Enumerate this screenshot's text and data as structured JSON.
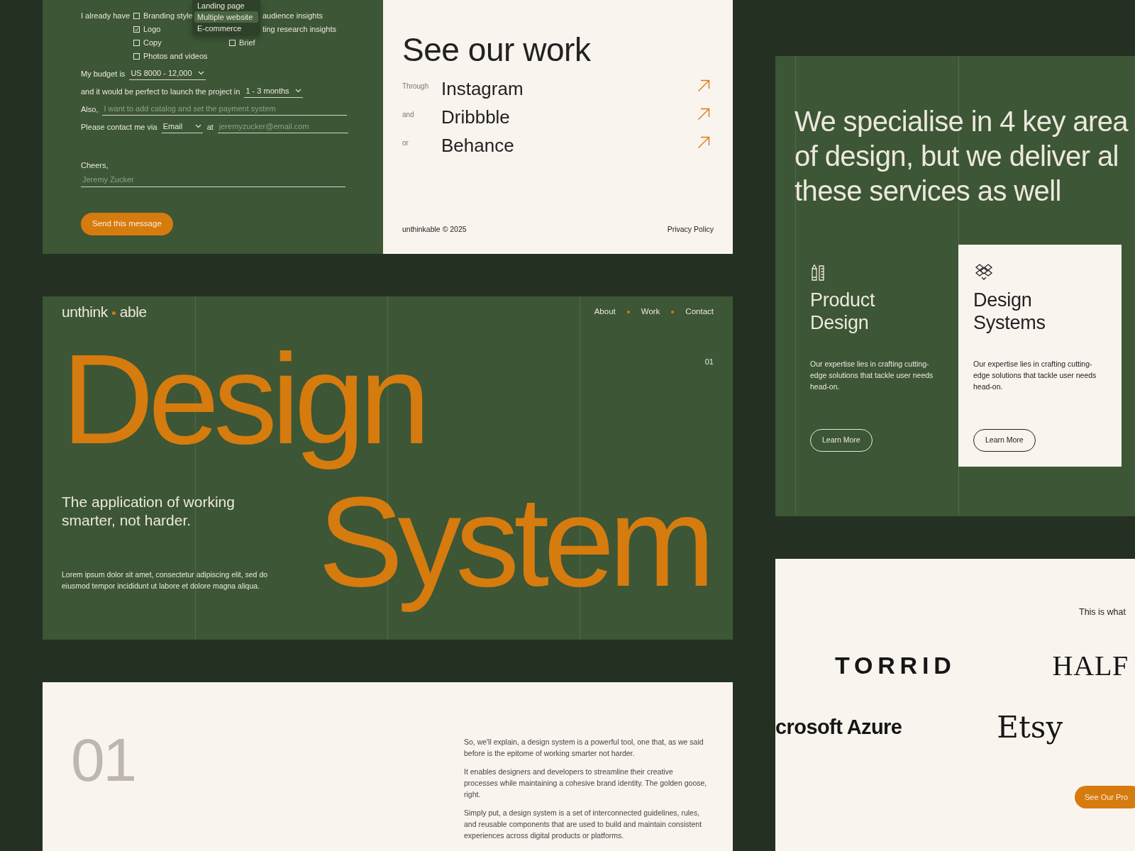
{
  "contact_form": {
    "have_label": "I already have",
    "options": [
      {
        "label": "Branding style",
        "checked": false
      },
      {
        "label": "Logo",
        "checked": true
      },
      {
        "label": "Copy",
        "checked": false
      },
      {
        "label": "Photos and videos",
        "checked": false
      }
    ],
    "options_2": [
      {
        "label": "audience insights"
      },
      {
        "label": "ting research insights"
      },
      {
        "label": "Brief",
        "checked": false
      }
    ],
    "dropdown": [
      {
        "label": "Landing page",
        "selected": false
      },
      {
        "label": "Multiple website",
        "selected": true
      },
      {
        "label": "E-commerce",
        "selected": false
      }
    ],
    "budget": {
      "label": "My budget is",
      "value": "US 8000 - 12,000"
    },
    "launch": {
      "label": "and it would be perfect to launch the project in",
      "value": "1 - 3 months"
    },
    "also": {
      "label": "Also,",
      "placeholder": "I want to add catalog and set the payment system"
    },
    "contact": {
      "label": "Please contact me via",
      "value": "Email",
      "at_label": "at",
      "placeholder": "jeremyzucker@email.com"
    },
    "closing": "Cheers,",
    "name": {
      "placeholder": "Jeremy Zucker"
    },
    "send_button": "Send this message"
  },
  "work": {
    "title": "See our work",
    "links": [
      {
        "prefix": "Through",
        "label": "Instagram"
      },
      {
        "prefix": "and",
        "label": "Dribbble"
      },
      {
        "prefix": "or",
        "label": "Behance"
      }
    ],
    "copyright": "unthinkable © 2025",
    "privacy": "Privacy Policy"
  },
  "hero": {
    "logo": [
      "unthink",
      "able"
    ],
    "nav": [
      "About",
      "Work",
      "Contact"
    ],
    "index": "01",
    "headline": [
      "Design",
      "System"
    ],
    "tagline": "The application of working smarter, not harder.",
    "body": "Lorem ipsum dolor sit amet, consectetur adipiscing elit, sed do eiusmod tempor incididunt ut labore et dolore magna aliqua."
  },
  "intro": {
    "number": "01",
    "paragraphs": [
      "So, we'll explain, a design system is a powerful tool, one that, as we said before is the epitome of working smarter not harder.",
      "It enables designers and developers to streamline their creative processes while maintaining a cohesive brand identity. The golden goose, right.",
      "Simply put, a design system is a set of interconnected guidelines, rules, and reusable components that are used to build and maintain consistent experiences across digital products or platforms."
    ]
  },
  "services": {
    "heading": [
      "We specialise in 4 key area",
      "of design, but we deliver al",
      "these services as well"
    ],
    "cards": [
      {
        "title": "Product Design",
        "description": "Our expertise lies in crafting cutting-edge solutions that tackle user needs head-on.",
        "button": "Learn More",
        "selected": false
      },
      {
        "title": "Design Systems",
        "description": "Our expertise lies in crafting cutting-edge solutions that tackle user needs head-on.",
        "button": "Learn More",
        "selected": true
      }
    ]
  },
  "clients": {
    "caption": "This is what",
    "logos": [
      {
        "label": "TORRID",
        "kind": "spaced"
      },
      {
        "label": "HALF",
        "kind": "serif"
      },
      {
        "label": "crosoft Azure",
        "kind": "sans"
      },
      {
        "label": "Etsy",
        "kind": "serif-large"
      }
    ],
    "button": "See Our Pro"
  }
}
